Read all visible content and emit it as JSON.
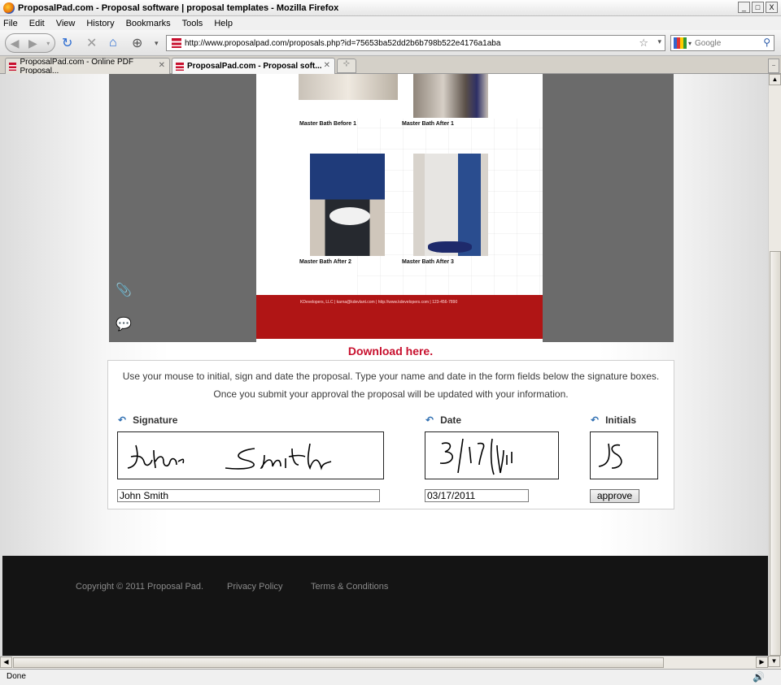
{
  "window": {
    "title": "ProposalPad.com - Proposal software | proposal templates - Mozilla Firefox",
    "min": "_",
    "max": "□",
    "close": "X"
  },
  "menu": [
    "File",
    "Edit",
    "View",
    "History",
    "Bookmarks",
    "Tools",
    "Help"
  ],
  "nav": {
    "url": "http://www.proposalpad.com/proposals.php?id=75653ba52dd2b6b798b522e4176a1aba",
    "search_placeholder": "Google"
  },
  "tabs": [
    {
      "label": "ProposalPad.com - Online PDF Proposal...",
      "active": false
    },
    {
      "label": "ProposalPad.com - Proposal soft...",
      "active": true
    }
  ],
  "pdf": {
    "captions": [
      "Master Bath Before 1",
      "Master Bath After 1",
      "Master Bath After 2",
      "Master Bath After 3"
    ],
    "footer_text": "KDevelopers, LLC  |  karna@kdevlant.com  |  http://www.kdevelopers.com  |  123-456-7890"
  },
  "download_label": "Download here.",
  "signing": {
    "instruction1": "Use your mouse to initial, sign and date the proposal. Type your name and date in the form fields below the signature boxes.",
    "instruction2": "Once you submit your approval the proposal will be updated with your information.",
    "signature_label": "Signature",
    "date_label": "Date",
    "initials_label": "Initials",
    "name_value": "John Smith",
    "date_value": "03/17/2011",
    "approve_label": "approve"
  },
  "footer": {
    "copyright": "Copyright © 2011 Proposal Pad.",
    "privacy": "Privacy Policy",
    "terms": "Terms & Conditions"
  },
  "status": "Done"
}
